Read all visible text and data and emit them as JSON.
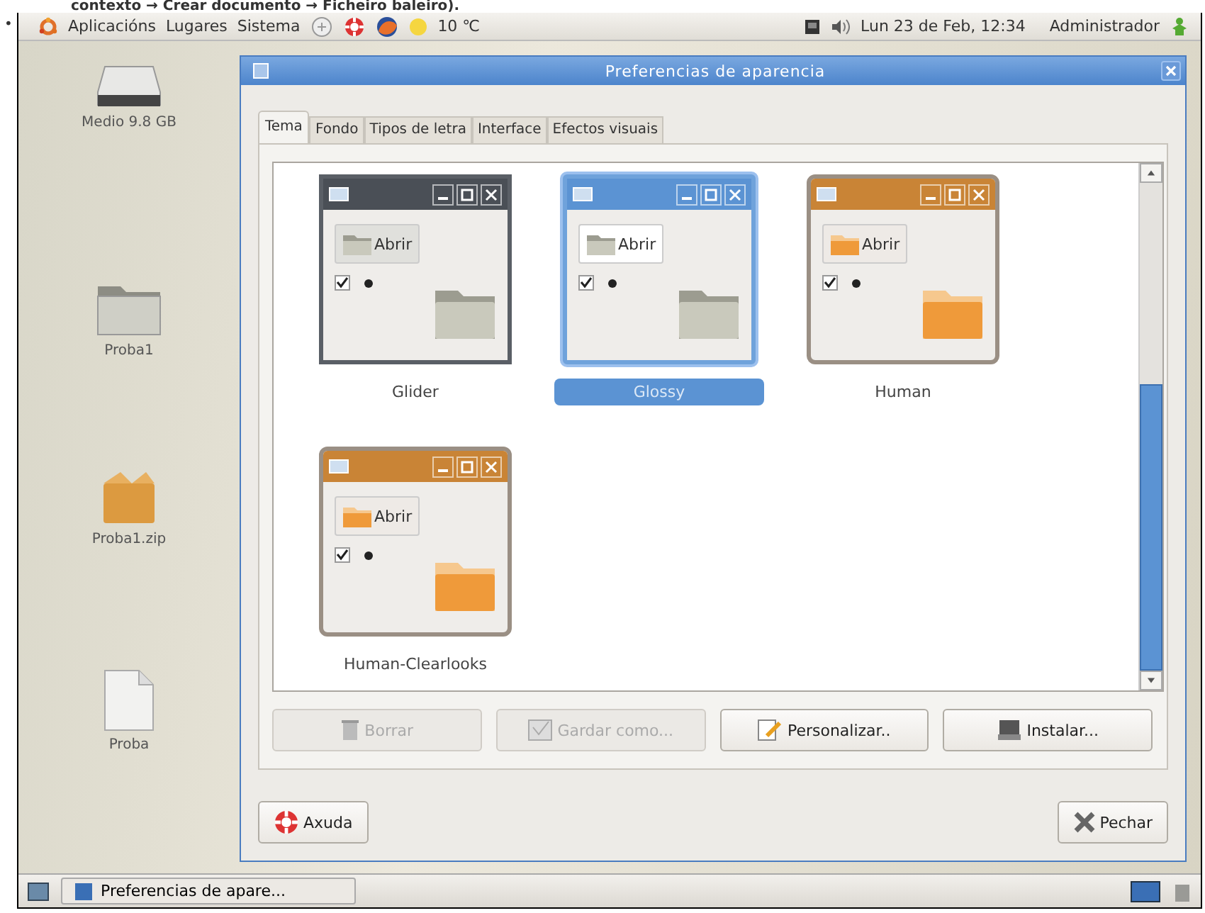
{
  "caption": {
    "bullet": "•",
    "text": "contexto → Crear documento → Ficheiro baleiro)."
  },
  "top_panel": {
    "menus": [
      "Aplicacións",
      "Lugares",
      "Sistema"
    ],
    "weather": "10 ℃",
    "clock": "Lun 23 de Feb, 12:34",
    "user": "Administrador"
  },
  "desktop_icons": [
    {
      "kind": "drive",
      "label": "Medio 9.8 GB"
    },
    {
      "kind": "folder",
      "label": "Proba1"
    },
    {
      "kind": "archive",
      "label": "Proba1.zip"
    },
    {
      "kind": "file",
      "label": "Proba"
    }
  ],
  "dialog": {
    "title": "Preferencias de aparencia",
    "tabs": [
      {
        "label": "Tema",
        "selected": true
      },
      {
        "label": "Fondo",
        "selected": false
      },
      {
        "label": "Tipos de letra",
        "selected": false
      },
      {
        "label": "Interface",
        "selected": false
      },
      {
        "label": "Efectos visuais",
        "selected": false
      }
    ],
    "themes": [
      {
        "name": "Glider",
        "kind": "glider",
        "button_label": "Abrir",
        "selected": false
      },
      {
        "name": "Glossy",
        "kind": "glossy",
        "button_label": "Abrir",
        "selected": true
      },
      {
        "name": "Human",
        "kind": "human",
        "button_label": "Abrir",
        "selected": false
      },
      {
        "name": "Human-Clearlooks",
        "kind": "human",
        "button_label": "Abrir",
        "selected": false
      }
    ],
    "actions": [
      {
        "kind": "delete",
        "label": "Borrar",
        "disabled": true
      },
      {
        "kind": "save",
        "label": "Gardar como...",
        "disabled": true
      },
      {
        "kind": "customize",
        "label": "Personalizar..",
        "disabled": false
      },
      {
        "kind": "install",
        "label": "Instalar...",
        "disabled": false
      }
    ],
    "help_button": "Axuda",
    "close_button": "Pechar"
  },
  "taskbar": {
    "window_button": "Preferencias de apare..."
  }
}
